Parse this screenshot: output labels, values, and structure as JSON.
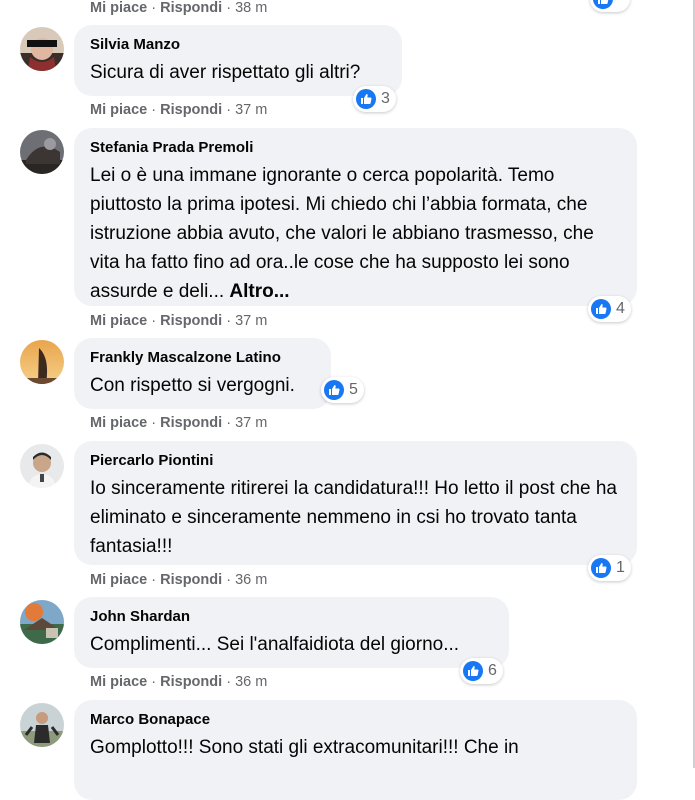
{
  "top_row": {
    "like": "Mi piace",
    "reply": "Rispondi",
    "time": "38 m"
  },
  "labels": {
    "sep": "·",
    "more": "Altro..."
  },
  "comments": [
    {
      "author": "Silvia Manzo",
      "text": "Sicura di aver rispettato gli altri?",
      "likes": "3",
      "like": "Mi piace",
      "reply": "Rispondi",
      "time": "37 m"
    },
    {
      "author": "Stefania Prada Premoli",
      "text": "Lei o è una immane ignorante o cerca popolarità. Temo piuttosto la prima ipotesi. Mi chiedo chi l’abbia formata, che istruzione abbia avuto, che valori le abbiano trasmesso, che vita ha fatto fino ad ora..le cose che ha supposto lei sono assurde e deli... ",
      "likes": "4",
      "like": "Mi piace",
      "reply": "Rispondi",
      "time": "37 m"
    },
    {
      "author": "Frankly Mascalzone Latino",
      "text": "Con rispetto si vergogni.",
      "likes": "5",
      "like": "Mi piace",
      "reply": "Rispondi",
      "time": "37 m"
    },
    {
      "author": "Piercarlo Piontini",
      "text": "Io sinceramente ritirerei la candidatura!!! Ho letto il post che ha eliminato e sinceramente nemmeno in csi ho trovato tanta fantasia!!!",
      "likes": "1",
      "like": "Mi piace",
      "reply": "Rispondi",
      "time": "36 m"
    },
    {
      "author": "John Shardan",
      "text": "Complimenti... Sei l'analfaidiota del giorno...",
      "likes": "6",
      "like": "Mi piace",
      "reply": "Rispondi",
      "time": "36 m"
    },
    {
      "author": "Marco Bonapace",
      "text": "Gomplotto!!! Sono stati gli extracomunitari!!! Che in"
    }
  ],
  "colors": {
    "bubble": "#f0f2f5",
    "like_blue": "#1877f2",
    "meta_gray": "#65676b"
  }
}
